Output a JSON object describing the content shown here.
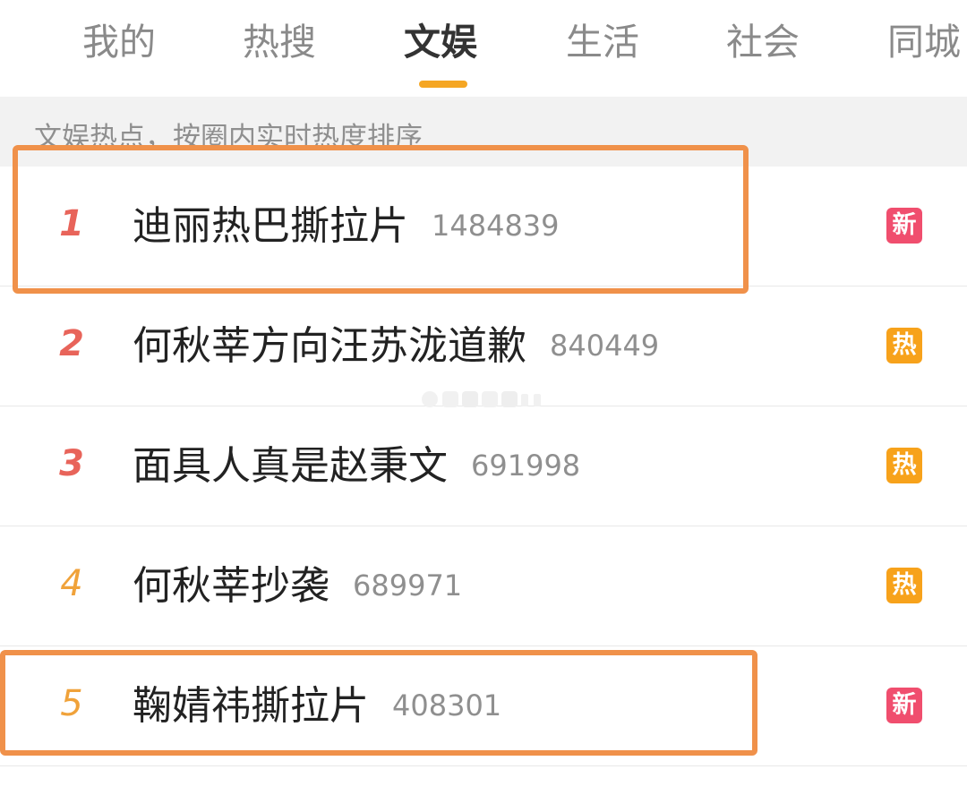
{
  "tabs": [
    {
      "label": "我的"
    },
    {
      "label": "热搜"
    },
    {
      "label": "文娱"
    },
    {
      "label": "生活"
    },
    {
      "label": "社会"
    },
    {
      "label": "同城"
    }
  ],
  "active_tab": "文娱",
  "section_header": "文娱热点，按圈内实时热度排序",
  "items": [
    {
      "rank": "1",
      "title": "迪丽热巴撕拉片",
      "count": "1484839",
      "badge": "新",
      "highlighted": true
    },
    {
      "rank": "2",
      "title": "何秋莘方向汪苏泷道歉",
      "count": "840449",
      "badge": "热",
      "highlighted": false
    },
    {
      "rank": "3",
      "title": "面具人真是赵秉文",
      "count": "691998",
      "badge": "热",
      "highlighted": false
    },
    {
      "rank": "4",
      "title": "何秋莘抄袭",
      "count": "689971",
      "badge": "热",
      "highlighted": false
    },
    {
      "rank": "5",
      "title": "鞠婧祎撕拉片",
      "count": "408301",
      "badge": "新",
      "highlighted": true
    }
  ],
  "colors": {
    "accent": "#f5a623",
    "rank_top3": "#e8645a",
    "rank_other": "#f0a23a",
    "badge_new": "#f04e6e",
    "badge_hot": "#f7a21b",
    "highlight_box": "#f0914a"
  }
}
